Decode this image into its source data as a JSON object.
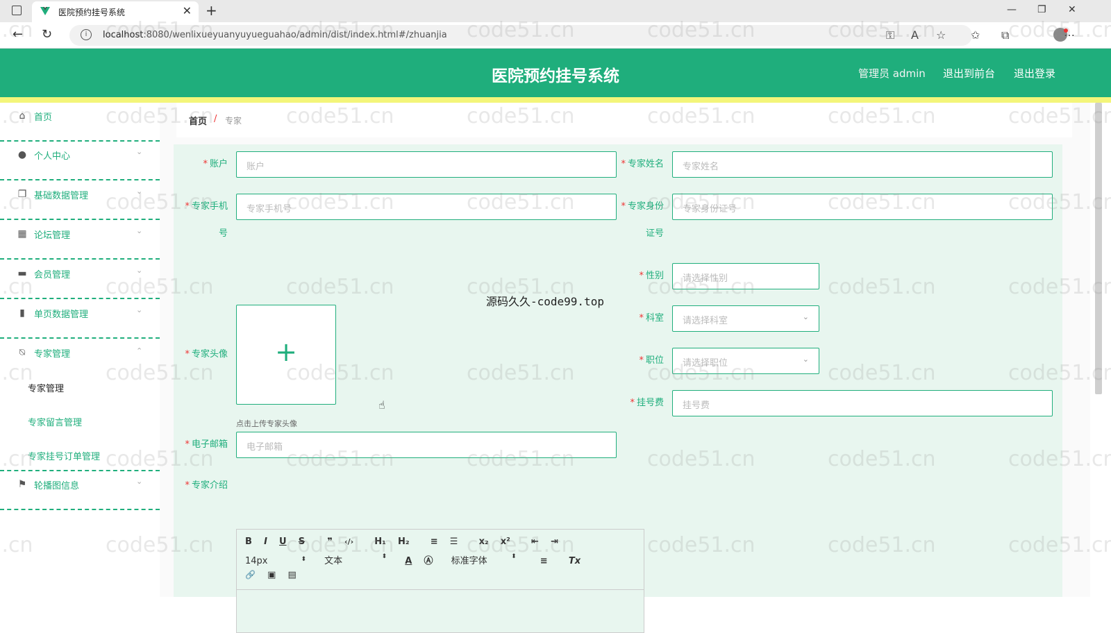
{
  "browser": {
    "tab_title": "医院预约挂号系统",
    "new_tab": "+",
    "close_tab": "✕",
    "url_host": "localhost",
    "url_rest": ":8080/wenlixueyuanyuyueguahao/admin/dist/index.html#/zhuanjia"
  },
  "header": {
    "title": "医院预约挂号系统",
    "user": "管理员 admin",
    "back_front": "退出到前台",
    "logout": "退出登录"
  },
  "sidebar": {
    "items": [
      {
        "label": "首页"
      },
      {
        "label": "个人中心"
      },
      {
        "label": "基础数据管理"
      },
      {
        "label": "论坛管理"
      },
      {
        "label": "会员管理"
      },
      {
        "label": "单页数据管理"
      },
      {
        "label": "专家管理"
      },
      {
        "label": "轮播图信息"
      }
    ],
    "sub_items": [
      "专家管理",
      "专家留言管理",
      "专家挂号订单管理"
    ]
  },
  "breadcrumb": {
    "home": "首页",
    "sep": "/",
    "current": "专家"
  },
  "form": {
    "account": {
      "label": "账户",
      "placeholder": "账户"
    },
    "name": {
      "label": "专家姓名",
      "placeholder": "专家姓名"
    },
    "phone": {
      "label_line1": "专家手机",
      "label_line2": "号",
      "placeholder": "专家手机号"
    },
    "idcard": {
      "label_line1": "专家身份",
      "label_line2": "证号",
      "placeholder": "专家身份证号"
    },
    "avatar": {
      "label": "专家头像",
      "tip": "点击上传专家头像",
      "plus": "+"
    },
    "gender": {
      "label": "性别",
      "placeholder": "请选择性别"
    },
    "dept": {
      "label": "科室",
      "placeholder": "请选择科室"
    },
    "position": {
      "label": "职位",
      "placeholder": "请选择职位"
    },
    "fee": {
      "label": "挂号费",
      "placeholder": "挂号费"
    },
    "email": {
      "label": "电子邮箱",
      "placeholder": "电子邮箱"
    },
    "intro": {
      "label": "专家介绍"
    },
    "required_mark": "*"
  },
  "editor": {
    "row1": [
      "B",
      "I",
      "U",
      "S",
      "❞",
      "‹/›",
      "H₁",
      "H₂",
      "≡",
      "☰",
      "x₂",
      "x²",
      "⇤",
      "⇥"
    ],
    "font_size": "14px",
    "text_type": "文本",
    "font_family": "标准字体",
    "row2_icons": [
      "A",
      "Ⓐ",
      "≡",
      "Tx"
    ],
    "row3": [
      "🔗",
      "▣",
      "▤"
    ]
  },
  "watermarks": {
    "text": "code51.cn",
    "center": "源码久久-code99.top"
  }
}
